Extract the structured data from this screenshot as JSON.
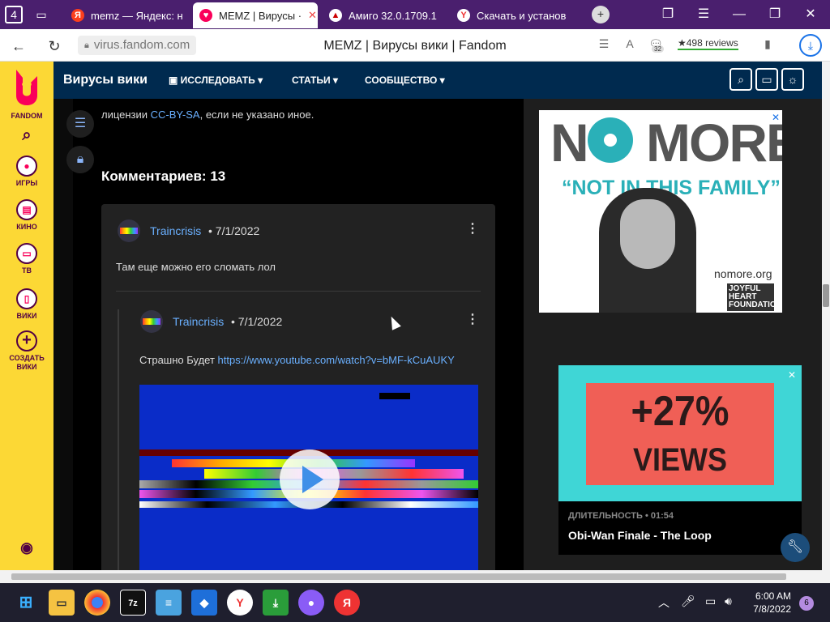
{
  "browser": {
    "tab_count": "4",
    "tabs": [
      {
        "title": "memz — Яндекс: н",
        "favicon": "Я",
        "color": "#fc3f1d"
      },
      {
        "title": "MEMZ | Вирусы ·",
        "favicon": "♥",
        "color": "#fa005a",
        "active": true
      },
      {
        "title": "Амиго 32.0.1709.1",
        "favicon": "▲",
        "color": "#c00"
      },
      {
        "title": "Скачать и установ",
        "favicon": "Y",
        "color": "#e33"
      }
    ],
    "url": "virus.fandom.com",
    "page_title": "MEMZ | Вирусы вики | Fandom",
    "reviews": "★498 reviews",
    "badge": "32"
  },
  "sidebar": {
    "brand": "FANDOM",
    "items": [
      {
        "label": "ИГРЫ",
        "icon": "gamepad-icon"
      },
      {
        "label": "КИНО",
        "icon": "film-icon"
      },
      {
        "label": "ТВ",
        "icon": "tv-icon"
      },
      {
        "label": "ВИКИ",
        "icon": "book-icon"
      },
      {
        "label": "СОЗДАТЬ ВИКИ",
        "icon": "plus-icon"
      }
    ]
  },
  "wiki": {
    "name": "Вирусы вики",
    "nav": [
      "ИССЛЕДОВАТЬ",
      "СТАТЬИ",
      "СООБЩЕСТВО"
    ]
  },
  "article": {
    "license_prefix": "лицензии ",
    "license_link": "CC-BY-SA",
    "license_suffix": ", если не указано иное.",
    "comments_count": "Комментариев: 13",
    "comment": {
      "author": "Traincrisis",
      "date": "• 7/1/2022",
      "text": "Там еще можно его сломать лол"
    },
    "reply": {
      "author": "Traincrisis",
      "date": "• 7/1/2022",
      "text": "Страшно Будет ",
      "link": "https://www.youtube.com/watch?v=bMF-kCuAUKY"
    }
  },
  "ads": {
    "ad1": {
      "headline_a": "N",
      "headline_b": " MORE",
      "sub": "“NOT IN THIS FAMILY”",
      "url": "nomore.org",
      "sponsor": "JOYFUL HEART FOUNDATION"
    },
    "ad2": {
      "percent": "+27%",
      "views": "VIEWS",
      "duration": "ДЛИТЕЛЬНОСТЬ • 01:54",
      "video_title": "Obi-Wan Finale - The Loop"
    }
  },
  "taskbar": {
    "time": "6:00 AM",
    "date": "7/8/2022",
    "notifications": "6"
  }
}
